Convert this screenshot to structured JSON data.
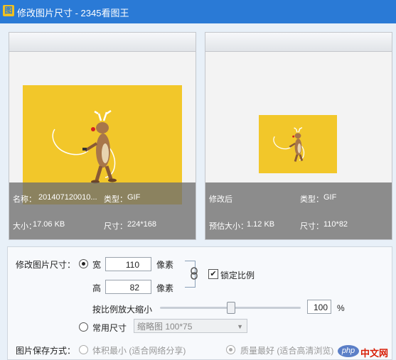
{
  "window": {
    "title": "修改图片尺寸 - 2345看图王",
    "icon_glyph": "图"
  },
  "original": {
    "name_label": "名称：",
    "name_value": "201407120010...",
    "type_label": "类型：",
    "type_value": "GIF",
    "size_label": "大小：",
    "size_value": "17.06 KB",
    "dims_label": "尺寸：",
    "dims_value": "224*168"
  },
  "modified": {
    "title": "修改后",
    "type_label": "类型：",
    "type_value": "GIF",
    "est_size_label": "预估大小：",
    "est_size_value": "1.12 KB",
    "dims_label": "尺寸：",
    "dims_value": "110*82"
  },
  "settings": {
    "modify_size_label": "修改图片尺寸：",
    "width_label": "宽",
    "width_value": "110",
    "width_unit": "像素",
    "height_label": "高",
    "height_value": "82",
    "height_unit": "像素",
    "lock_label": "锁定比例",
    "lock_checked": true,
    "scale_label": "按比例放大缩小",
    "scale_value": "100",
    "scale_unit": "%",
    "scale_fraction": 0.5,
    "common_size_label": "常用尺寸",
    "common_size_selected": "缩略图 100*75",
    "save_mode_label": "图片保存方式：",
    "save_option_small": "体积最小 (适合网络分享)",
    "save_option_quality": "质量最好 (适合高清浏览)"
  },
  "watermark": {
    "text": "php中文网"
  },
  "colors": {
    "title_bar": "#2a7ad6",
    "image_bg": "#f2c72a",
    "watermark_red": "#d81e06"
  }
}
